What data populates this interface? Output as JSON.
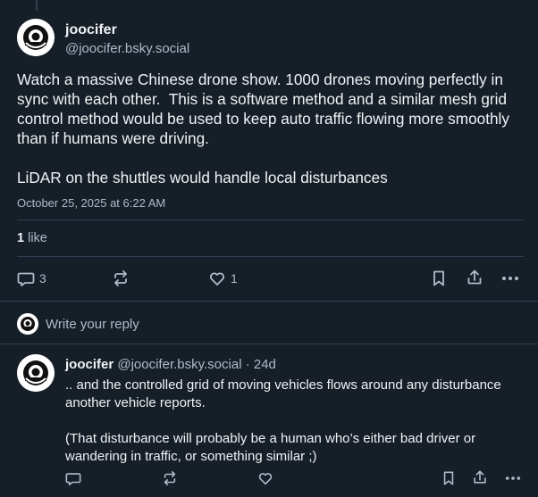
{
  "post": {
    "display_name": "joocifer",
    "handle": "@joocifer.bsky.social",
    "text": "Watch a massive Chinese drone show. 1000 drones moving perfectly in sync with each other.  This is a software method and a similar mesh grid control method would be used to keep auto traffic flowing more smoothly than if humans were driving.\n\nLiDAR on the shuttles would handle local disturbances",
    "timestamp": "October 25, 2025 at 6:22 AM",
    "like_count": "1",
    "like_label": " like",
    "actions": {
      "reply_count": "3",
      "repost_count": "",
      "like_count": "1"
    }
  },
  "reply_box": {
    "placeholder": "Write your reply"
  },
  "reply": {
    "display_name": "joocifer",
    "meta": " @joocifer.bsky.social · 24d",
    "text": ".. and the controlled grid of moving vehicles flows around any disturbance another vehicle reports.\n\n(That disturbance will probably be a human who’s either bad driver or wandering in traffic, or something similar ;)"
  },
  "colors": {
    "background": "#161e27",
    "text": "#f1f3f5",
    "muted": "#aebbc9",
    "divider": "#2e4052"
  },
  "icons": [
    "avatar-logo",
    "comment-icon",
    "repost-icon",
    "heart-icon",
    "bookmark-icon",
    "share-icon",
    "more-icon"
  ]
}
